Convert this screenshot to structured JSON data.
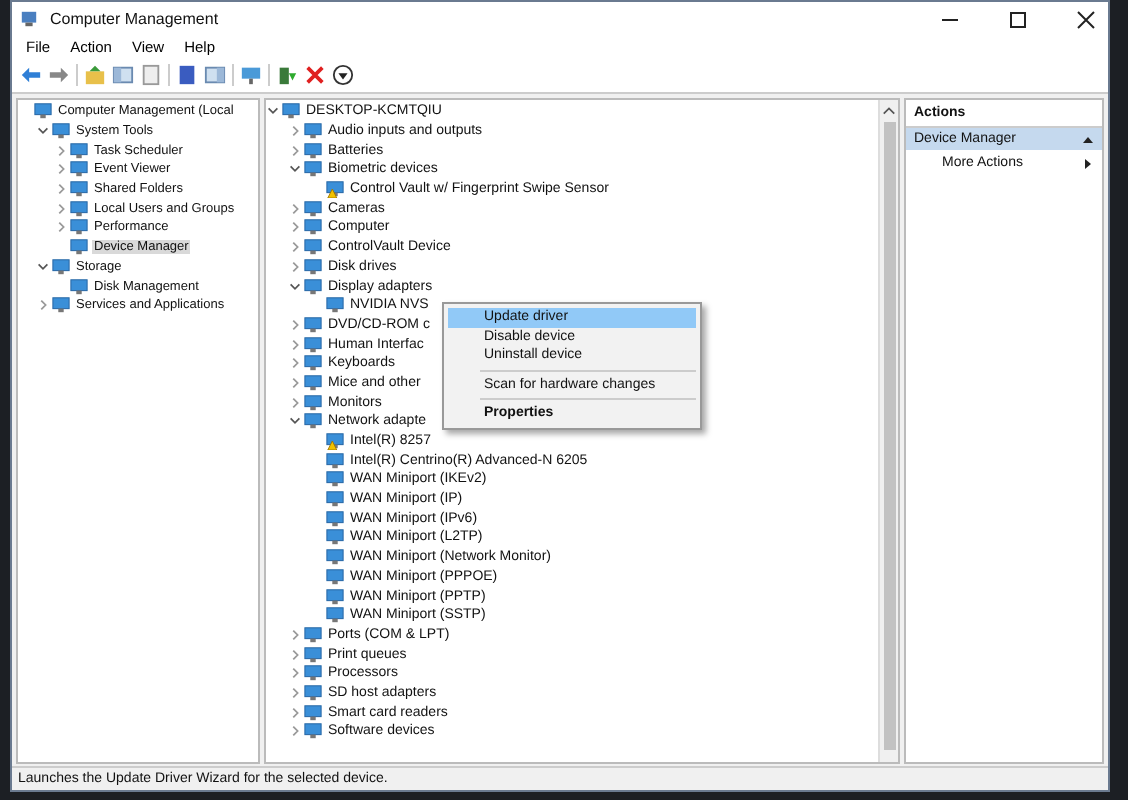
{
  "window": {
    "title": "Computer Management"
  },
  "menu": [
    "File",
    "Action",
    "View",
    "Help"
  ],
  "console_tree": [
    {
      "label": "Computer Management (Local",
      "children": [
        {
          "label": "System Tools",
          "expanded": true,
          "selected": false,
          "children": [
            {
              "label": "Task Scheduler",
              "expanded": false,
              "selected": false
            },
            {
              "label": "Event Viewer",
              "expanded": false,
              "selected": false
            },
            {
              "label": "Shared Folders",
              "expanded": false,
              "selected": false
            },
            {
              "label": "Local Users and Groups",
              "expanded": false,
              "selected": false
            },
            {
              "label": "Performance",
              "expanded": false,
              "selected": false
            },
            {
              "label": "Device Manager",
              "selected": true
            }
          ]
        },
        {
          "label": "Storage",
          "expanded": true,
          "selected": false,
          "children": [
            {
              "label": "Disk Management",
              "selected": false
            }
          ]
        },
        {
          "label": "Services and Applications",
          "expanded": false,
          "selected": false
        }
      ],
      "selected": false
    }
  ],
  "device_tree": [
    {
      "label": "DESKTOP-KCMTQIU",
      "expanded": true,
      "children": [
        {
          "label": "Audio inputs and outputs",
          "expanded": false
        },
        {
          "label": "Batteries",
          "expanded": false
        },
        {
          "label": "Biometric devices",
          "expanded": true,
          "children": [
            {
              "label": "Control Vault w/ Fingerprint Swipe Sensor",
              "warning": true
            }
          ]
        },
        {
          "label": "Cameras",
          "expanded": false
        },
        {
          "label": "Computer",
          "expanded": false
        },
        {
          "label": "ControlVault Device",
          "expanded": false
        },
        {
          "label": "Disk drives",
          "expanded": false
        },
        {
          "label": "Display adapters",
          "expanded": true,
          "children": [
            {
              "label": "NVIDIA NVS",
              "warning": false
            }
          ]
        },
        {
          "label": "DVD/CD-ROM c",
          "expanded": false
        },
        {
          "label": "Human Interfac",
          "expanded": false
        },
        {
          "label": "Keyboards",
          "expanded": false
        },
        {
          "label": "Mice and other",
          "expanded": false
        },
        {
          "label": "Monitors",
          "expanded": false
        },
        {
          "label": "Network adapte",
          "expanded": true,
          "children": [
            {
              "label": "Intel(R) 8257",
              "warning": true
            },
            {
              "label": "Intel(R) Centrino(R) Advanced-N 6205",
              "warning": false
            },
            {
              "label": "WAN Miniport (IKEv2)",
              "warning": false
            },
            {
              "label": "WAN Miniport (IP)",
              "warning": false
            },
            {
              "label": "WAN Miniport (IPv6)",
              "warning": false
            },
            {
              "label": "WAN Miniport (L2TP)",
              "warning": false
            },
            {
              "label": "WAN Miniport (Network Monitor)",
              "warning": false
            },
            {
              "label": "WAN Miniport (PPPOE)",
              "warning": false
            },
            {
              "label": "WAN Miniport (PPTP)",
              "warning": false
            },
            {
              "label": "WAN Miniport (SSTP)",
              "warning": false
            }
          ]
        },
        {
          "label": "Ports (COM & LPT)",
          "expanded": false
        },
        {
          "label": "Print queues",
          "expanded": false
        },
        {
          "label": "Processors",
          "expanded": false
        },
        {
          "label": "SD host adapters",
          "expanded": false
        },
        {
          "label": "Smart card readers",
          "expanded": false
        },
        {
          "label": "Software devices",
          "expanded": false
        }
      ]
    }
  ],
  "context_menu": [
    {
      "kind": "item",
      "label": "Update driver",
      "selected": true
    },
    {
      "kind": "item",
      "label": "Disable device",
      "selected": false
    },
    {
      "kind": "item",
      "label": "Uninstall device",
      "selected": false
    },
    {
      "kind": "separator"
    },
    {
      "kind": "item",
      "label": "Scan for hardware changes",
      "selected": false
    },
    {
      "kind": "separator"
    },
    {
      "kind": "default",
      "label": "Properties",
      "selected": false
    }
  ],
  "actions": {
    "title": "Actions",
    "section": {
      "label": "Device Manager",
      "expanded": true
    },
    "items": [
      {
        "label": "More Actions"
      }
    ]
  },
  "status_bar": "Launches the Update Driver Wizard for the selected device."
}
